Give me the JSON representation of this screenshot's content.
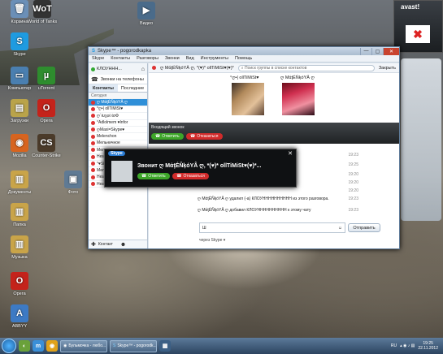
{
  "desktop": {
    "icons": [
      {
        "label": "Корзина",
        "glyph": "🗑",
        "color": "#6b8fb7"
      },
      {
        "label": "World of Tanks",
        "glyph": "WoT",
        "color": "#333"
      },
      {
        "label": "Skype",
        "glyph": "S",
        "color": "#1f9be0"
      },
      {
        "label": "Компьютер",
        "glyph": "▭",
        "color": "#4a7fb0"
      },
      {
        "label": "uTorrent",
        "glyph": "µ",
        "color": "#2e8d2e"
      },
      {
        "label": "Загрузки",
        "glyph": "▤",
        "color": "#b9a34a"
      },
      {
        "label": "Opera",
        "glyph": "O",
        "color": "#c4231b"
      },
      {
        "label": "Mozilla",
        "glyph": "◉",
        "color": "#d7641f"
      },
      {
        "label": "Counter-Strike",
        "glyph": "CS",
        "color": "#4b3b2a"
      },
      {
        "label": "Фото",
        "glyph": "▣",
        "color": "#5f7a94"
      },
      {
        "label": "Документы",
        "glyph": "▥",
        "color": "#c9a449"
      },
      {
        "label": "Папка",
        "glyph": "▥",
        "color": "#c9a449"
      },
      {
        "label": "Музыка",
        "glyph": "▥",
        "color": "#c9a449"
      },
      {
        "label": "Opera",
        "glyph": "O",
        "color": "#c4231b"
      },
      {
        "label": "ABBYY",
        "glyph": "A",
        "color": "#3d7ac4"
      }
    ]
  },
  "media": {
    "label": "Видео"
  },
  "skype": {
    "title": "Skype™ - pogorodkapka",
    "menu": [
      "Skype",
      "Контакты",
      "Разговоры",
      "Звонки",
      "Вид",
      "Инструменты",
      "Помощь"
    ],
    "user": "КЛОУННН...",
    "call_phones": "Звонки на телефоны",
    "tabs": [
      "Контакты",
      "Последние"
    ],
    "today": "Сегодня",
    "contacts": [
      "ღ MάţÉŇķóYÂ ღ",
      "°ღ•| ollTiMiSt♥",
      "ღ`ℓυχυℓ ℓσΦ",
      "°Adlolmem ♥lnfor",
      "ღMaxi=Skype♥",
      "Melenchon",
      "Мельничное",
      "Мельничное",
      "Незабудка к Байу...",
      "°♥Sheesha°♥°",
      "Мельничное",
      "Незабудка к Байу...",
      "Незабудка к Байу..."
    ],
    "add_contact": "Контакт",
    "search_placeholder": "Поиск группы в списке контактов",
    "close_label": "Закрыть",
    "chat_title": "ღ MάţÉŇķóYÂ ღ, *(♥)* ollTiMiSt♥(♥)*",
    "participant1": "°ღ•| ollTiMiSt♥",
    "participant2": "ღ MάţÉŇķóYÂ ღ",
    "incoming": "Входящий звонок",
    "answer": "Ответить",
    "decline": "Отказаться",
    "history": [
      {
        "text": "ღ MάţÉŇķóYÂ ღ удалил (-а) КЛОУНННННННННН из этого разговора.",
        "time": "19:23"
      },
      {
        "text": "ღ MάţÉŇķóYÂ ღ добавил КЛОУНННННННННН к этому чату",
        "time": "19:23"
      }
    ],
    "times": [
      "19:23",
      "19:25",
      "19:20",
      "19:20",
      "19:20",
      "19:23",
      "19:23"
    ],
    "input_value": "Ш",
    "send": "Отправить",
    "via": "через Skype ▾"
  },
  "popup": {
    "brand": "Skype",
    "caller": "Звонит ღ MάţÉŇķóYÂ ღ, *(♥)* ollTiMiSt♥(♥)*...",
    "answer": "Ответить",
    "decline": "Отказаться"
  },
  "avast": {
    "brand": "avast!"
  },
  "taskbar": {
    "tasks": [
      "Бульмочка - любо...",
      "Skype™ - pogorodk..."
    ],
    "lang": "RU",
    "time": "19:25",
    "date": "22.11.2012"
  }
}
